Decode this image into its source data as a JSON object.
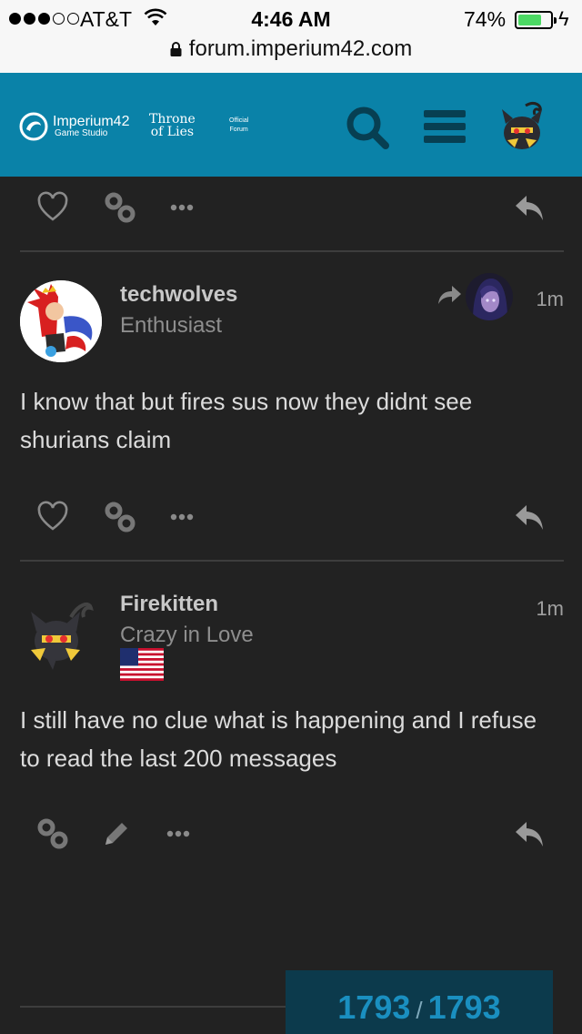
{
  "status": {
    "carrier": "AT&T",
    "time": "4:46 AM",
    "battery": "74%",
    "battery_level": 0.74,
    "signal_bars": 3,
    "signal_total": 5
  },
  "browser": {
    "url": "forum.imperium42.com"
  },
  "header": {
    "brand_name": "Imperium42",
    "brand_sub": "Game Studio",
    "game_line1": "Throne",
    "game_line2": "of Lies",
    "forum_line1": "Official",
    "forum_line2": "Forum",
    "accent": "#0a82a8"
  },
  "posts": [
    {
      "username": "techwolves",
      "title": "Enthusiast",
      "age": "1m",
      "body": "I know that but fires sus now they didnt see shurians claim"
    },
    {
      "username": "Firekitten",
      "title": "Crazy in Love",
      "age": "1m",
      "body": "I still have no clue what is happening and I refuse to read the last 200 messages"
    }
  ],
  "progress": {
    "current": "1793",
    "separator": "/",
    "total": "1793"
  },
  "icons": [
    "heart-icon",
    "link-icon",
    "more-icon",
    "reply-icon",
    "edit-icon",
    "share-icon",
    "search-icon",
    "menu-icon",
    "lock-icon"
  ]
}
